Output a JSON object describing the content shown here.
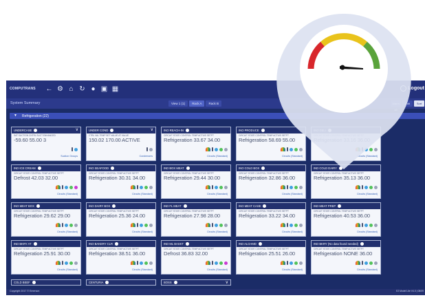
{
  "app": {
    "logo_text": "COMPUTRANS",
    "logout_label": "Logout",
    "subtitle": "System Summary",
    "view_tabs": [
      {
        "label": "View 1 (1)"
      },
      {
        "label": "Rack A"
      },
      {
        "label": "Rack B"
      }
    ],
    "right_tabs": [
      {
        "label": "Alarm All"
      },
      {
        "label": "Edit"
      },
      {
        "label": "Sort"
      }
    ],
    "group_label": "Refrigeration (22)",
    "copyright": "Copyright 2017 © Emerson",
    "version": "E2 Model Lite V4.0 | 08/09"
  },
  "cards": [
    {
      "title": "UNDERCASE",
      "labels": "SAT SUCTION  CNTRL SUCT  ENHANCED",
      "main": "-59.60",
      "main2": "55.00",
      "main3": "3",
      "footer": "Suction Groups",
      "chevron": true,
      "icons": [
        "therm",
        "blue"
      ]
    },
    {
      "title": "UNDER COND",
      "labels": "CTRL VAL TEMP  SET VALUE  AT VALUE",
      "main": "150.02",
      "main2": "170.00",
      "main3": "ACTIVE",
      "footer": "Condensers",
      "chevron": true,
      "icons": [
        "therm",
        "gray"
      ]
    },
    {
      "title": "INO REACH-IN",
      "labels": "CIRCUIT STATE  CONTROL TEMP  ACTIVE SETPT",
      "main": "Refrigeration",
      "main2": "33.67",
      "main3": "34.00",
      "footer": "Circuits (Standard)",
      "chevron": false,
      "icons": [
        "flame",
        "therm",
        "blue",
        "green",
        "gray"
      ]
    },
    {
      "title": "INO PRODUCE",
      "labels": "CIRCUIT STATE  CONTROL TEMP  ACTIVE SETPT",
      "main": "Refrigeration",
      "main2": "58.69",
      "main3": "55.00",
      "footer": "Circuits (Standard)",
      "chevron": false,
      "icons": [
        "flame",
        "therm",
        "blue",
        "green",
        "gray"
      ]
    },
    {
      "title": "INO DELI",
      "labels": "CIRCUIT STATE  CONTROL TEMP  ACTIVE SETPT",
      "main": "Refrigeration",
      "main2": "33.16",
      "main3": "36.00",
      "footer": "Circuits (Standard)",
      "chevron": false,
      "icons": [
        "flame",
        "therm",
        "blue",
        "green",
        "gray"
      ]
    },
    {
      "title": "IND ICE CREAM",
      "labels": "CIRCUIT STATE  CONTROL TEMP  ACTIVE SETPT",
      "main": "Defrost",
      "main2": "42.03",
      "main3": "32.00",
      "footer": "Circuits (Standard)",
      "chevron": false,
      "icons": [
        "flame",
        "therm",
        "blue",
        "green",
        "magenta"
      ]
    },
    {
      "title": "INO SEAFOOD",
      "labels": "CIRCUIT STATE  CONTROL TEMP  ACTIVE SETPT",
      "main": "Refrigeration",
      "main2": "30.31",
      "main3": "34.00",
      "footer": "Circuits (Standard)",
      "chevron": false,
      "icons": [
        "flame",
        "therm",
        "blue",
        "green",
        "gray"
      ]
    },
    {
      "title": "IND BOX MEAT",
      "labels": "CIRCUIT STATE  CONTROL TEMP  ACTIVE SETPT",
      "main": "Refrigeration",
      "main2": "29.44",
      "main3": "30.00",
      "footer": "Circuits (Standard)",
      "chevron": false,
      "icons": [
        "flame",
        "therm",
        "blue",
        "green",
        "gray"
      ]
    },
    {
      "title": "INO COLD BOX",
      "labels": "CIRCUIT STATE  CONTROL TEMP  ACTIVE SETPT",
      "main": "Refrigeration",
      "main2": "32.86",
      "main3": "36.00",
      "footer": "Circuits (Standard)",
      "chevron": false,
      "icons": [
        "flame",
        "therm",
        "blue",
        "green",
        "gray"
      ]
    },
    {
      "title": "IND COLD DAIRY",
      "labels": "CIRCUIT STATE  CONTROL TEMP  ACTIVE SETPT",
      "main": "Refrigeration",
      "main2": "35.13",
      "main3": "36.00",
      "footer": "Circuits (Standard)",
      "chevron": false,
      "icons": [
        "flame",
        "therm",
        "blue",
        "green",
        "gray"
      ]
    },
    {
      "title": "INO MEAT BOX",
      "labels": "CIRCUIT STATE  CONTROL TEMP  ACTIVE SETPT",
      "main": "Refrigeration",
      "main2": "29.62",
      "main3": "29.00",
      "footer": "Circuits (Standard)",
      "chevron": false,
      "icons": [
        "flame",
        "therm",
        "blue",
        "green",
        "gray"
      ]
    },
    {
      "title": "INO DAIRY BOX",
      "labels": "CIRCUIT STATE  CONTROL TEMP  ACTIVE SETPT",
      "main": "Refrigeration",
      "main2": "25.36",
      "main3": "24.00",
      "footer": "Circuits (Standard)",
      "chevron": false,
      "icons": [
        "flame",
        "therm",
        "blue",
        "green",
        "gray"
      ]
    },
    {
      "title": "IND FL MEAT",
      "labels": "CIRCUIT STATE  CONTROL TEMP  ACTIVE SETPT",
      "main": "Refrigeration",
      "main2": "27.98",
      "main3": "28.00",
      "footer": "Circuits (Standard)",
      "chevron": false,
      "icons": [
        "flame",
        "therm",
        "blue",
        "green",
        "gray"
      ]
    },
    {
      "title": "INO MEAT CASE",
      "labels": "CIRCUIT STATE  CONTROL TEMP  ACTIVE SETPT",
      "main": "Refrigeration",
      "main2": "33.22",
      "main3": "34.00",
      "footer": "Circuits (Standard)",
      "chevron": false,
      "icons": [
        "flame",
        "therm",
        "blue",
        "green",
        "gray"
      ]
    },
    {
      "title": "IND MEAT PREP",
      "labels": "CIRCUIT STATE  CONTROL TEMP  ACTIVE SETPT",
      "main": "Refrigeration",
      "main2": "40.53",
      "main3": "36.00",
      "footer": "Circuits (Standard)",
      "chevron": false,
      "icons": [
        "flame",
        "therm",
        "blue",
        "green",
        "gray"
      ]
    },
    {
      "title": "IND BKRY AT",
      "labels": "CIRCUIT STATE  CONTROL TEMP  ACTIVE SETPT",
      "main": "Refrigeration",
      "main2": "25.91",
      "main3": "30.00",
      "footer": "Circuits (Standard)",
      "chevron": false,
      "icons": [
        "flame",
        "therm",
        "blue",
        "green",
        "gray"
      ]
    },
    {
      "title": "INO BAKERY CLR",
      "labels": "CIRCUIT STATE  CONTROL TEMP  ACTIVE SETPT",
      "main": "Refrigeration",
      "main2": "38.51",
      "main3": "36.00",
      "footer": "Circuits (Standard)",
      "chevron": false,
      "icons": [
        "flame",
        "therm",
        "blue",
        "green",
        "gray"
      ]
    },
    {
      "title": "IND ML BASKT",
      "labels": "CIRCUIT STATE  CONTROL TEMP  ACTIVE SETPT",
      "main": "Defrost",
      "main2": "36.83",
      "main3": "32.00",
      "footer": "Circuits (Standard)",
      "chevron": false,
      "icons": [
        "flame",
        "therm",
        "blue",
        "green",
        "magenta"
      ]
    },
    {
      "title": "IND ALCHMD",
      "labels": "CIRCUIT STATE  CONTROL TEMP  ACTIVE SETPT",
      "main": "Refrigeration",
      "main2": "25.51",
      "main3": "26.00",
      "footer": "Circuits (Standard)",
      "chevron": false,
      "icons": [
        "flame",
        "therm",
        "blue",
        "green",
        "gray"
      ]
    },
    {
      "title": "IND BKRY (No data found needed)",
      "labels": "CIRCUIT STATE  CONTROL TEMP  ACTIVE SETPT",
      "main": "Refrigeration",
      "main2": "NONE",
      "main3": "36.00",
      "footer": "Circuits (Standard)",
      "chevron": false,
      "icons": [
        "flame",
        "therm",
        "blue",
        "green",
        "gray"
      ]
    }
  ],
  "stubs": [
    {
      "title": "COLD BEEF",
      "chevron": false
    },
    {
      "title": "CENTURIA",
      "chevron": false
    },
    {
      "title": "BOSS",
      "chevron": true
    }
  ],
  "gauge": {
    "colors": {
      "red": "#d8262b",
      "yellow": "#e9c31b",
      "green": "#5aa33b",
      "needle": "#111111",
      "pin": "#dde2f1"
    }
  },
  "theme": {
    "header": "#23307a",
    "accent": "#3b4fb8"
  }
}
